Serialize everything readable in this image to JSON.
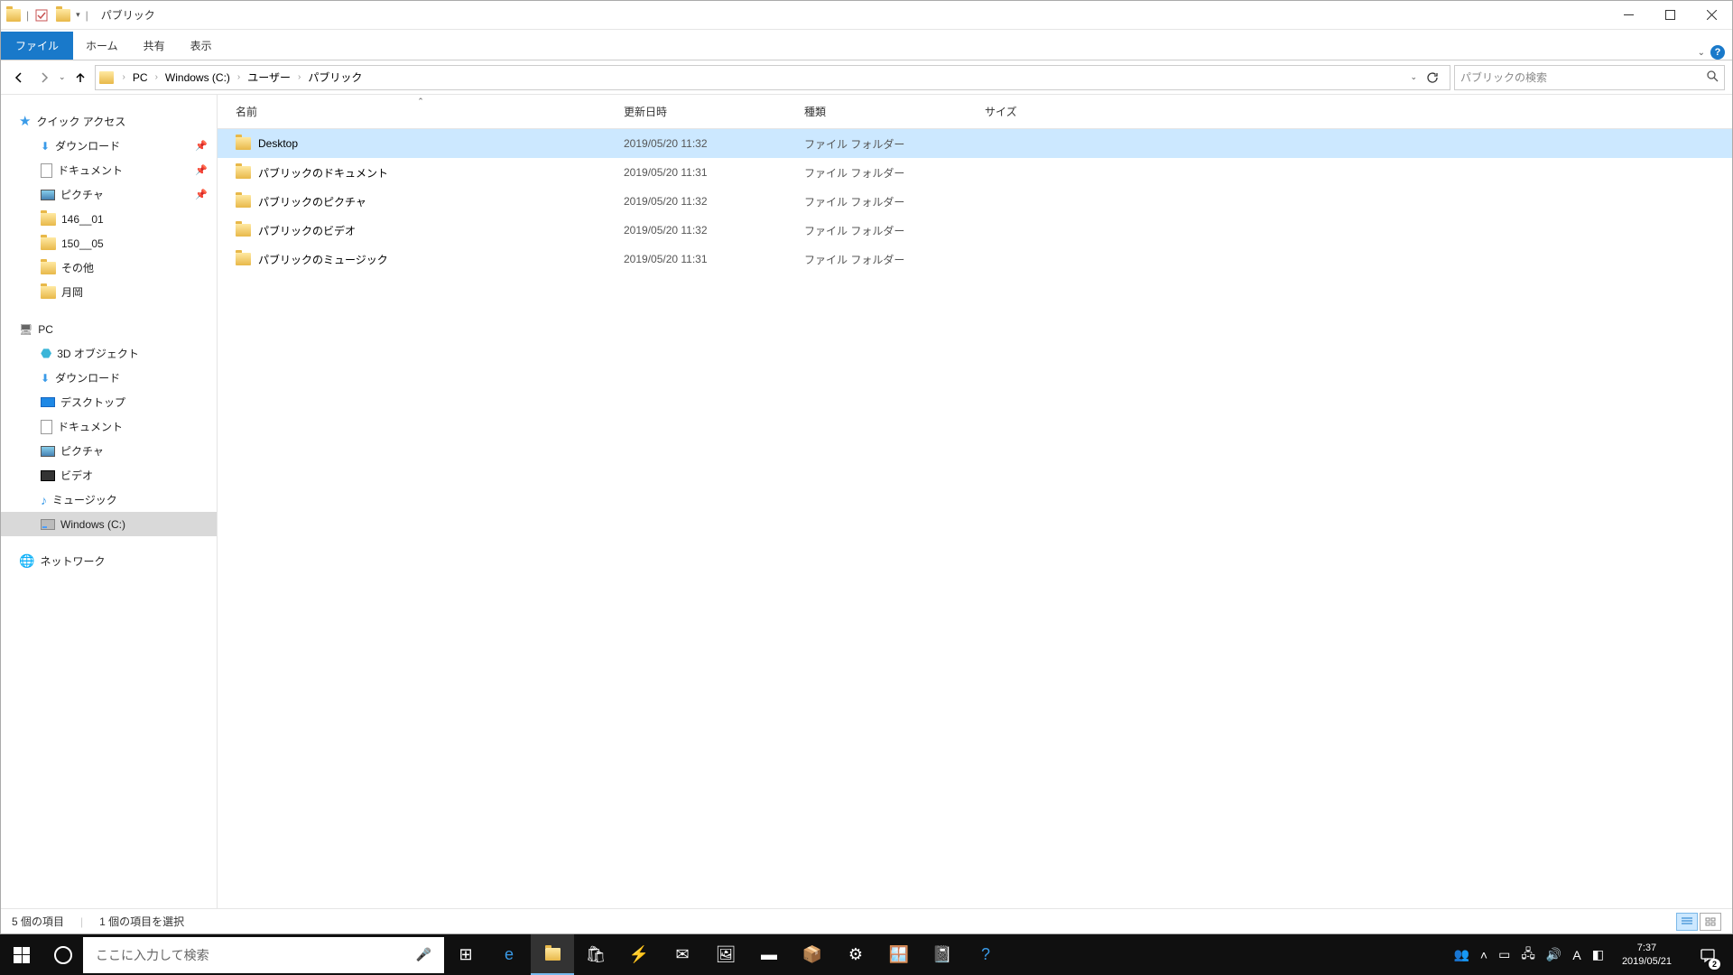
{
  "window": {
    "title": "パブリック"
  },
  "ribbon": {
    "file": "ファイル",
    "tabs": [
      "ホーム",
      "共有",
      "表示"
    ]
  },
  "breadcrumb": {
    "items": [
      "PC",
      "Windows (C:)",
      "ユーザー",
      "パブリック"
    ]
  },
  "search": {
    "placeholder": "パブリックの検索"
  },
  "columns": {
    "name": "名前",
    "date": "更新日時",
    "type": "種類",
    "size": "サイズ"
  },
  "files": [
    {
      "name": "Desktop",
      "date": "2019/05/20 11:32",
      "type": "ファイル フォルダー",
      "selected": true
    },
    {
      "name": "パブリックのドキュメント",
      "date": "2019/05/20 11:31",
      "type": "ファイル フォルダー",
      "selected": false
    },
    {
      "name": "パブリックのピクチャ",
      "date": "2019/05/20 11:32",
      "type": "ファイル フォルダー",
      "selected": false
    },
    {
      "name": "パブリックのビデオ",
      "date": "2019/05/20 11:32",
      "type": "ファイル フォルダー",
      "selected": false
    },
    {
      "name": "パブリックのミュージック",
      "date": "2019/05/20 11:31",
      "type": "ファイル フォルダー",
      "selected": false
    }
  ],
  "nav": {
    "quick_access": "クイック アクセス",
    "quick_items": [
      {
        "label": "ダウンロード",
        "icon": "dl",
        "pinned": true
      },
      {
        "label": "ドキュメント",
        "icon": "doc",
        "pinned": true
      },
      {
        "label": "ピクチャ",
        "icon": "pic",
        "pinned": true
      },
      {
        "label": "146__01",
        "icon": "folder",
        "pinned": false
      },
      {
        "label": "150__05",
        "icon": "folder",
        "pinned": false
      },
      {
        "label": "その他",
        "icon": "folder",
        "pinned": false
      },
      {
        "label": "月岡",
        "icon": "folder",
        "pinned": false
      }
    ],
    "pc": "PC",
    "pc_items": [
      {
        "label": "3D オブジェクト",
        "icon": "obj"
      },
      {
        "label": "ダウンロード",
        "icon": "dl"
      },
      {
        "label": "デスクトップ",
        "icon": "desk"
      },
      {
        "label": "ドキュメント",
        "icon": "doc"
      },
      {
        "label": "ピクチャ",
        "icon": "pic"
      },
      {
        "label": "ビデオ",
        "icon": "vid"
      },
      {
        "label": "ミュージック",
        "icon": "mus"
      },
      {
        "label": "Windows (C:)",
        "icon": "disk",
        "selected": true
      }
    ],
    "network": "ネットワーク"
  },
  "status": {
    "count": "5 個の項目",
    "selected": "1 個の項目を選択"
  },
  "taskbar": {
    "search_placeholder": "ここに入力して検索",
    "time": "7:37",
    "date": "2019/05/21",
    "notif_count": "2"
  }
}
